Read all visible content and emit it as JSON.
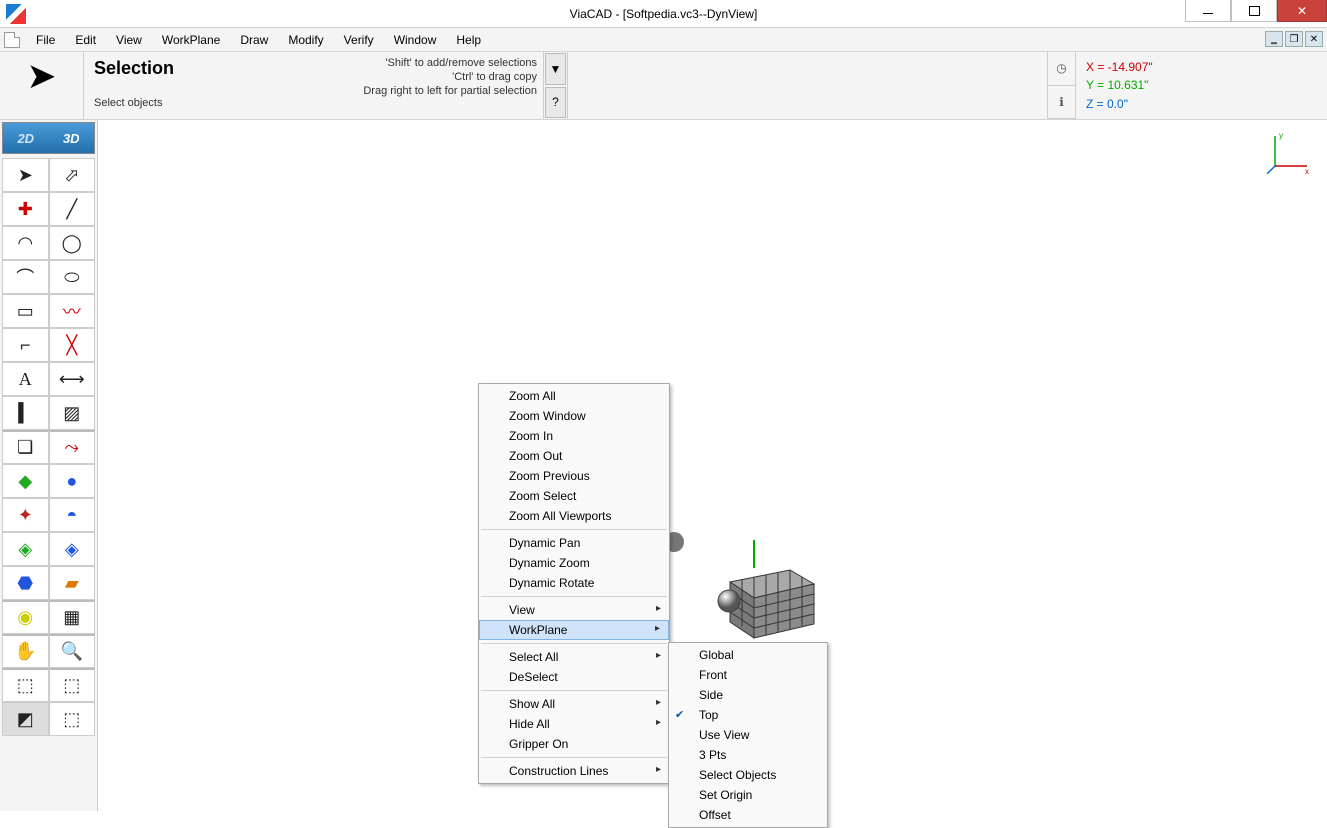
{
  "window": {
    "title": "ViaCAD - [Softpedia.vc3--DynView]"
  },
  "menubar": [
    "File",
    "Edit",
    "View",
    "WorkPlane",
    "Draw",
    "Modify",
    "Verify",
    "Window",
    "Help"
  ],
  "infobar": {
    "title": "Selection",
    "desc": "Select objects",
    "hints": [
      "'Shift' to add/remove selections",
      "'Ctrl' to drag copy",
      "Drag right to left for partial selection"
    ],
    "dropdown_glyph": "▼",
    "help_glyph": "?"
  },
  "coords": {
    "x_label": "X = -14.907\"",
    "y_label": "Y = 10.631\"",
    "z_label": "Z = 0.0\"",
    "clock_glyph": "◷",
    "info_glyph": "ℹ"
  },
  "view_toggle": {
    "left": "2D",
    "right": "3D"
  },
  "context_menu": {
    "groups": [
      [
        "Zoom All",
        "Zoom Window",
        "Zoom In",
        "Zoom Out",
        "Zoom Previous",
        "Zoom Select",
        "Zoom All Viewports"
      ],
      [
        "Dynamic Pan",
        "Dynamic Zoom",
        "Dynamic Rotate"
      ],
      [
        "View",
        "WorkPlane"
      ],
      [
        "Select All",
        "DeSelect"
      ],
      [
        "Show All",
        "Hide All",
        "Gripper On"
      ],
      [
        "Construction Lines"
      ]
    ],
    "submenu_parents": [
      "View",
      "WorkPlane",
      "Select All",
      "Show All",
      "Hide All",
      "Construction Lines"
    ],
    "highlighted": "WorkPlane"
  },
  "submenu": {
    "items": [
      "Global",
      "Front",
      "Side",
      "Top",
      "Use View",
      "3 Pts",
      "Select Objects",
      "Set Origin",
      "Offset"
    ],
    "checked": "Top"
  }
}
